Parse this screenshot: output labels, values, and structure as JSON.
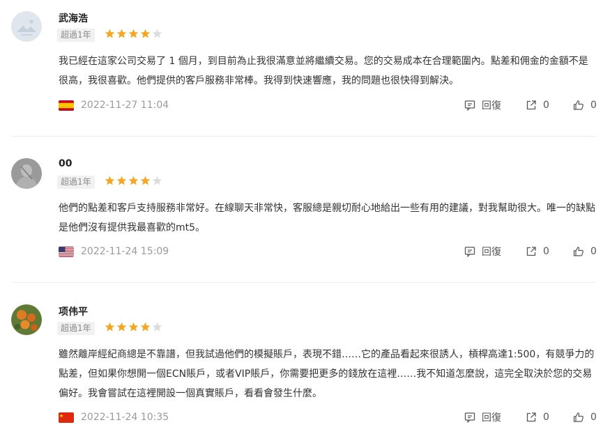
{
  "reviews": [
    {
      "name": "武海浩",
      "badge": "超過1年",
      "rating": 4,
      "text": "我已經在這家公司交易了 1 個月，到目前為止我很滿意並將繼續交易。您的交易成本在合理範圍內。點差和佣金的金額不是很高，我很喜歡。他們提供的客戶服務非常棒。我得到快速響應，我的問題也很快得到解決。",
      "flag": "es",
      "date": "2022-11-27 11:04",
      "reply_label": "回復",
      "share_count": "0",
      "like_count": "0"
    },
    {
      "name": "00",
      "badge": "超過1年",
      "rating": 4,
      "text": "他們的點差和客戶支持服務非常好。在線聊天非常快，客服總是親切耐心地給出一些有用的建議，對我幫助很大。唯一的缺點是他們沒有提供我最喜歡的mt5。",
      "flag": "us",
      "date": "2022-11-24 15:09",
      "reply_label": "回復",
      "share_count": "0",
      "like_count": "0"
    },
    {
      "name": "项伟平",
      "badge": "超過1年",
      "rating": 4,
      "text": "雖然離岸經紀商總是不靠譜，但我試過他們的模擬賬戶，表現不錯……它的產品看起來很誘人，槓桿高達1:500，有競爭力的點差，但如果你想開一個ECN賬戶，或者VIP賬戶，你需要把更多的錢放在這裡……我不知道怎麼說，這完全取決於您的交易偏好。我會嘗試在這裡開設一個真實賬戶，看看會發生什麼。",
      "flag": "cn",
      "date": "2022-11-24 10:35",
      "reply_label": "回復",
      "share_count": "0",
      "like_count": "0"
    }
  ],
  "colors": {
    "star_filled": "#f5a623",
    "star_empty": "#dcdcdc",
    "muted": "#9a9a9a"
  }
}
